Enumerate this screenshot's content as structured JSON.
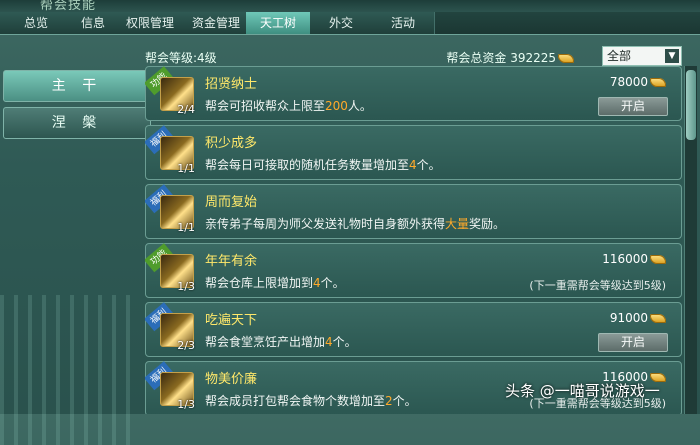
{
  "window": {
    "title": "帮会技能"
  },
  "tabs": [
    {
      "label": "总览",
      "active": false
    },
    {
      "label": "信息",
      "active": false
    },
    {
      "label": "权限管理",
      "active": false
    },
    {
      "label": "资金管理",
      "active": false
    },
    {
      "label": "天工树",
      "active": true
    },
    {
      "label": "外交",
      "active": false
    },
    {
      "label": "活动",
      "active": false
    }
  ],
  "leftnav": [
    {
      "label": "主 干",
      "active": true
    },
    {
      "label": "涅 槃",
      "active": false
    }
  ],
  "header": {
    "guild_level": "帮会等级:4级",
    "fund": "帮会总资金 392225",
    "filter_value": "全部",
    "coin_icon": "gold-ingot-icon"
  },
  "rows": [
    {
      "tag": "功能",
      "tag_type": "func",
      "title": "招贤纳士",
      "count": "2/4",
      "desc_pre": "帮会可招收帮众上限至",
      "desc_hl": "200",
      "desc_post": "人。",
      "cost": "78000",
      "button": "开启",
      "requirement": ""
    },
    {
      "tag": "福利",
      "tag_type": "welfare",
      "title": "积少成多",
      "count": "1/1",
      "desc_pre": "帮会每日可接取的随机任务数量增加至",
      "desc_hl": "4",
      "desc_post": "个。",
      "cost": "",
      "button": "",
      "requirement": ""
    },
    {
      "tag": "福利",
      "tag_type": "welfare",
      "title": "周而复始",
      "count": "1/1",
      "desc_pre": "亲传弟子每周为师父发送礼物时自身额外获得",
      "desc_hl": "大量",
      "desc_post": "奖励。",
      "cost": "",
      "button": "",
      "requirement": ""
    },
    {
      "tag": "功能",
      "tag_type": "func",
      "title": "年年有余",
      "count": "1/3",
      "desc_pre": "帮会仓库上限增加到",
      "desc_hl": "4",
      "desc_post": "个。",
      "cost": "116000",
      "button": "",
      "requirement": "(下一重需帮会等级达到5级)"
    },
    {
      "tag": "福利",
      "tag_type": "welfare",
      "title": "吃遍天下",
      "count": "2/3",
      "desc_pre": "帮会食堂烹饪产出增加",
      "desc_hl": "4",
      "desc_post": "个。",
      "cost": "91000",
      "button": "开启",
      "requirement": ""
    },
    {
      "tag": "福利",
      "tag_type": "welfare",
      "title": "物美价廉",
      "count": "1/3",
      "desc_pre": "帮会成员打包帮会食物个数增加至",
      "desc_hl": "2",
      "desc_post": "个。",
      "cost": "116000",
      "button": "",
      "requirement": "(下一重需帮会等级达到5级)"
    }
  ],
  "watermark": "头条 @一喵哥说游戏一"
}
